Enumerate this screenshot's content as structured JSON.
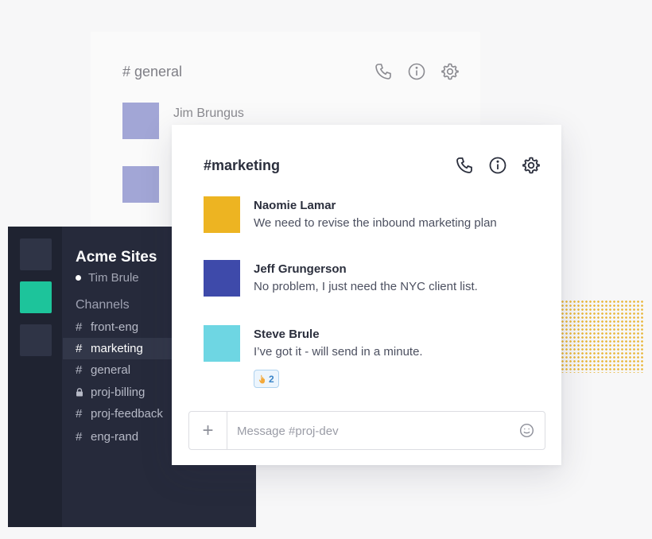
{
  "back_card": {
    "channel_title": "# general",
    "user_name": "Jim Brungus",
    "avatar_color": "#a2a6d6",
    "icons": [
      "phone-icon",
      "info-icon",
      "gear-icon"
    ]
  },
  "sidebar": {
    "workspace_name": "Acme Sites",
    "current_user": "Tim Brule",
    "section_label": "Channels",
    "workspace_colors": [
      "#2f3446",
      "#1dc49b",
      "#2f3446"
    ],
    "channels": [
      {
        "prefix": "#",
        "name": "front-eng",
        "active": false,
        "private": false
      },
      {
        "prefix": "#",
        "name": "marketing",
        "active": true,
        "private": false
      },
      {
        "prefix": "#",
        "name": "general",
        "active": false,
        "private": false
      },
      {
        "prefix": "",
        "name": "proj-billing",
        "active": false,
        "private": true
      },
      {
        "prefix": "#",
        "name": "proj-feedback",
        "active": false,
        "private": false
      },
      {
        "prefix": "#",
        "name": "eng-rand",
        "active": false,
        "private": false
      }
    ]
  },
  "chat": {
    "channel_title": "#marketing",
    "icons": [
      "phone-icon",
      "info-icon",
      "gear-icon"
    ],
    "messages": [
      {
        "author": "Naomie Lamar",
        "text": "We need to revise the inbound marketing plan",
        "avatar_color": "#edb422"
      },
      {
        "author": "Jeff Grungerson",
        "text": "No problem, I just need the NYC client list.",
        "avatar_color": "#3e4aaa"
      },
      {
        "author": "Steve Brule",
        "text": "I’ve got it - will send in a minute.",
        "avatar_color": "#6ed6e3",
        "reaction": {
          "icon": "hand-emoji-icon",
          "count": "2"
        }
      }
    ],
    "composer": {
      "add_label": "+",
      "placeholder": "Message #proj-dev"
    }
  },
  "accent_colors": {
    "dots": "#e9b73a",
    "active_workspace": "#1dc49b"
  }
}
